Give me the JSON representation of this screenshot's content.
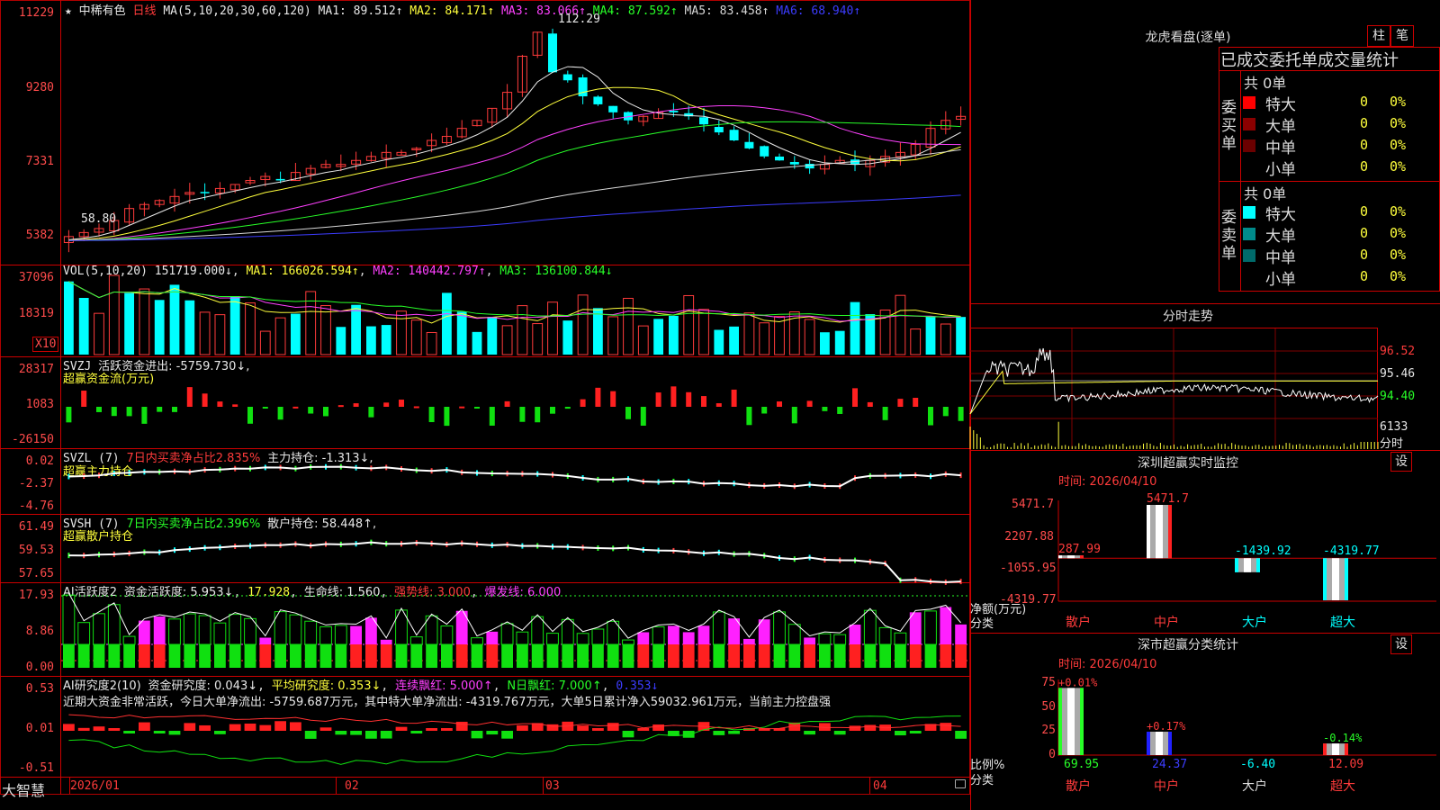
{
  "app": {
    "brand": "大智慧"
  },
  "main": {
    "star": "★",
    "stock_name": "中稀有色",
    "period": "日线",
    "ma_title": "MA(5,10,20,30,60,120)",
    "ma_values": [
      {
        "label": "MA1:",
        "value": "89.512↑",
        "color": "#e8e8e8"
      },
      {
        "label": "MA2:",
        "value": "84.171↑",
        "color": "#ffff3c"
      },
      {
        "label": "MA3:",
        "value": "83.066↑",
        "color": "#ff40ff"
      },
      {
        "label": "MA4:",
        "value": "87.592↑",
        "color": "#28ff28"
      },
      {
        "label": "MA5:",
        "value": "83.458↑",
        "color": "#d8d8d8"
      },
      {
        "label": "MA6:",
        "value": "68.940↑",
        "color": "#3c3cff"
      }
    ],
    "price_axis": [
      "11229",
      "9280",
      "7331",
      "5382"
    ],
    "high_label": "112.29",
    "low_label": "58.80",
    "date_axis": [
      "2026/01",
      "02",
      "03",
      "04"
    ]
  },
  "vol": {
    "title": "VOL(5,10,20)",
    "value": "151719.000↓",
    "ma1": "MA1: 166026.594↑",
    "ma2": "MA2: 140442.797↑",
    "ma3": "MA3: 136100.844↓",
    "axis": [
      "37096",
      "18319"
    ],
    "unit": "X10"
  },
  "svzj": {
    "title": "SVZJ",
    "line": "活跃资金进出: -5759.730↓,",
    "sub": "超赢资金流(万元)",
    "axis": [
      "28317",
      "1083",
      "-26150"
    ]
  },
  "svzl": {
    "title": "SVZL (7)",
    "stat": "7日内买卖净占比2.835%",
    "line": "主力持仓: -1.313↓,",
    "sub": "超赢主力持仓",
    "axis": [
      "0.02",
      "-2.37",
      "-4.76"
    ]
  },
  "svsh": {
    "title": "SVSH (7)",
    "stat": "7日内买卖净占比2.396%",
    "line": "散户持仓: 58.448↑,",
    "sub": "超赢散户持仓",
    "axis": [
      "61.49",
      "59.53",
      "57.65"
    ]
  },
  "ai_act": {
    "title": "AI活跃度2",
    "v1": "资金活跃度: 5.953↓",
    "v2": "17.928",
    "v3": "生命线: 1.560",
    "v4": "强势线: 3.000",
    "v5": "爆发线: 6.000",
    "axis": [
      "17.93",
      "8.86",
      "0.00"
    ]
  },
  "ai_res": {
    "title": "AI研究度2(10)",
    "v1": "资金研究度: 0.043↓",
    "v2": "平均研究度: 0.353↓",
    "v3": "连续飘红: 5.000↑",
    "v4": "N日飘红: 7.000↑",
    "v5": "0.353↓",
    "comment": "近期大资金非常活跃，今日大单净流出: -5759.687万元，其中特大单净流出: -4319.767万元，大单5日累计净入59032.961万元，当前主力控盘强",
    "axis": [
      "0.53",
      "0.01",
      "-0.51"
    ]
  },
  "right": {
    "lhb_title": "龙虎看盘(逐单)",
    "btn_zhu": "柱",
    "btn_bi": "笔",
    "tab_label": "已成交委托单成交量统计",
    "buy_group": {
      "side": "委买单",
      "total": "共 0单",
      "rows": [
        {
          "label": "特大",
          "count": "0",
          "pct": "0%",
          "color": "#ff0000"
        },
        {
          "label": "大单",
          "count": "0",
          "pct": "0%",
          "color": "#8b0000"
        },
        {
          "label": "中单",
          "count": "0",
          "pct": "0%",
          "color": "#6b0000"
        },
        {
          "label": "小单",
          "count": "0",
          "pct": "0%",
          "color": "#000000"
        }
      ]
    },
    "sell_group": {
      "side": "委卖单",
      "total": "共 0单",
      "rows": [
        {
          "label": "特大",
          "count": "0",
          "pct": "0%",
          "color": "#00ffff"
        },
        {
          "label": "大单",
          "count": "0",
          "pct": "0%",
          "color": "#008b8b"
        },
        {
          "label": "中单",
          "count": "0",
          "pct": "0%",
          "color": "#006b6b"
        },
        {
          "label": "小单",
          "count": "0",
          "pct": "0%",
          "color": "#000000"
        }
      ]
    },
    "intraday": {
      "title": "分时走势",
      "axis": [
        "96.52",
        "95.46",
        "94.40"
      ],
      "vol_axis": [
        "6133",
        "分时"
      ]
    },
    "sz_monitor": {
      "title": "深圳超赢实时监控",
      "btn": "设",
      "time": "时间: 2026/04/10",
      "axis": [
        "5471.7",
        "2207.88",
        "-1055.95",
        "-4319.77"
      ],
      "ylabel": "净额(万元)",
      "xlabel": "分类",
      "chart_data": {
        "type": "bar",
        "categories": [
          "散户",
          "中户",
          "大户",
          "超大"
        ],
        "values": [
          287.99,
          5471.7,
          -1439.92,
          -4319.77
        ],
        "labels": [
          "287.99",
          "5471.7",
          "-1439.92",
          "-4319.77"
        ],
        "ylim": [
          -4319.77,
          5471.7
        ]
      }
    },
    "sz_class": {
      "title": "深市超赢分类统计",
      "btn": "设",
      "time": "时间: 2026/04/10",
      "axis": [
        "75",
        "50",
        "25",
        "0"
      ],
      "ylabel": "比例%",
      "xlabel": "分类",
      "chart_data": {
        "type": "bar",
        "categories": [
          "散户",
          "中户",
          "大户",
          "超大"
        ],
        "values": [
          69.95,
          24.37,
          -6.4,
          12.09
        ],
        "changes": [
          "+0.01%",
          "+0.17%",
          "",
          "-0.14%"
        ],
        "labels": [
          "69.95",
          "24.37",
          "-6.40",
          "12.09"
        ],
        "ylim": [
          0,
          75
        ]
      }
    }
  }
}
